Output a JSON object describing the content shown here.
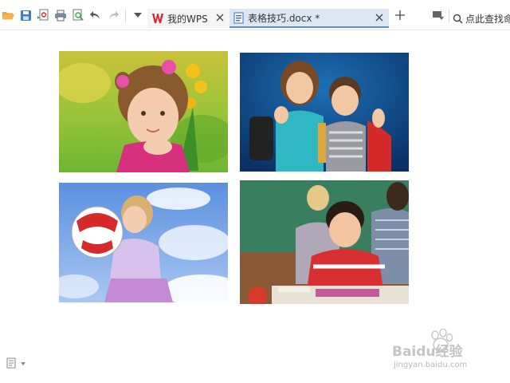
{
  "toolbar": {
    "icons": [
      "open-folder-icon",
      "save-icon",
      "export-pdf-icon",
      "print-icon",
      "print-preview-icon",
      "undo-icon",
      "redo-icon",
      "customize-dropdown-icon"
    ]
  },
  "tabs": [
    {
      "label": "我的WPS",
      "icon": "wps-logo-icon",
      "active": false
    },
    {
      "label": "表格技巧.docx *",
      "icon": "doc-file-icon",
      "active": true
    }
  ],
  "search": {
    "label": "点此查找命令"
  },
  "document": {
    "images": [
      {
        "name": "girl-with-flowers-photo"
      },
      {
        "name": "students-thumbs-up-photo"
      },
      {
        "name": "girl-with-soccer-ball-photo"
      },
      {
        "name": "boy-at-classroom-desk-photo"
      }
    ]
  },
  "watermark": {
    "brand": "Baidu经验",
    "url": "jingyan.baidu.com"
  },
  "colors": {
    "accent": "#5b8fd6",
    "wps_red": "#d9262c",
    "active_tab": "#dde7f4"
  }
}
